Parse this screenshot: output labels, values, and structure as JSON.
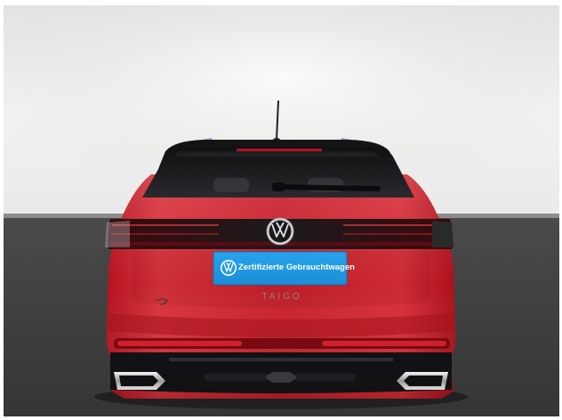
{
  "photo": {
    "subject": "car-rear-view",
    "colors": {
      "wall": "#ebebea",
      "floor": "#3c3c3c",
      "body": "#c61e27",
      "plate": "#1e9ae4",
      "glass": "#1b1b1d"
    }
  },
  "plate": {
    "text": "Zertifizierte Gebrauchtwagen"
  },
  "badge": {
    "model": "TAIGO"
  }
}
